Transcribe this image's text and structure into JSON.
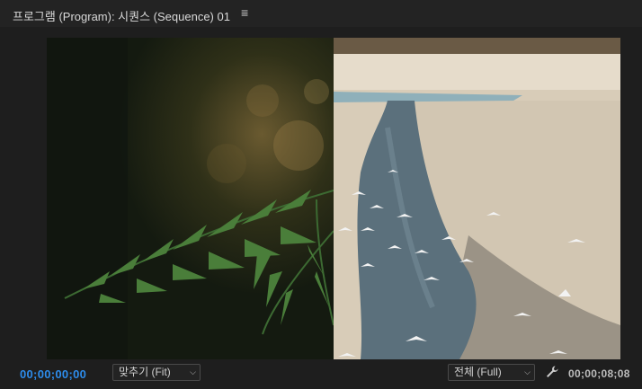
{
  "panel": {
    "title": "프로그램 (Program): 시퀀스 (Sequence) 01",
    "menu_icon": "hamburger-icon"
  },
  "viewer": {
    "left_clip": "fern-leaves",
    "right_clip": "river-with-birds"
  },
  "controls": {
    "current_timecode": "00;00;00;00",
    "zoom_dropdown": "맞추기 (Fit)",
    "resolution_dropdown": "전체 (Full)",
    "settings_icon": "wrench-icon",
    "duration_timecode": "00;00;08;08"
  },
  "colors": {
    "accent_timecode": "#2d8ceb",
    "panel_bg": "#1e1e1e"
  }
}
